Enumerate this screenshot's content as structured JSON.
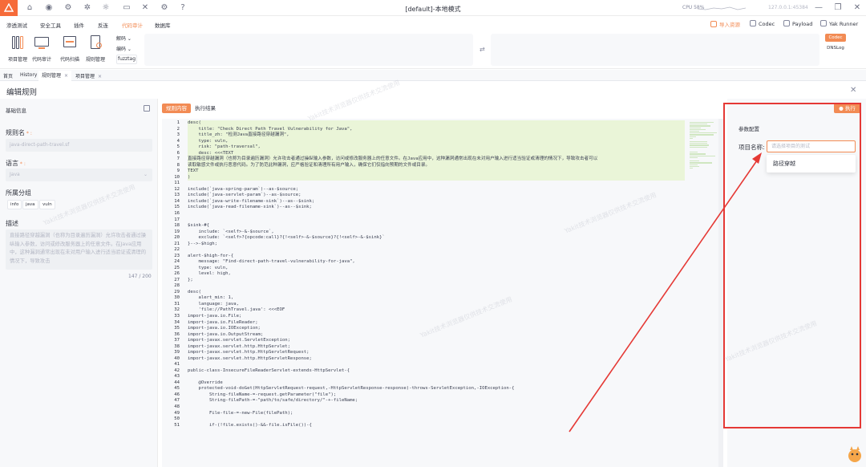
{
  "window": {
    "title": "[default]-本地模式",
    "cpu_label": "CPU 58%",
    "ip": "127.0.0.1:45384"
  },
  "menu": {
    "items": [
      "渗透测试",
      "安全工具",
      "插件",
      "反连",
      "代码审计",
      "数据库"
    ],
    "active": "代码审计",
    "right": {
      "import": "导入资源",
      "codec": "Codec",
      "payload": "Payload",
      "runner": "Yak Runner"
    }
  },
  "toolbar": {
    "tools": [
      "项目管理",
      "代码审计",
      "代码扫描",
      "规则管理"
    ],
    "decode": "解码",
    "encode": "编码",
    "fuzztag": "fuzztag",
    "codec_tag": "Codec",
    "dnslog": "DNSLog"
  },
  "tabs": [
    {
      "label": "首页"
    },
    {
      "label": "History"
    },
    {
      "label": "规则管理"
    },
    {
      "label": "项目管理"
    }
  ],
  "page": {
    "title": "编辑规则"
  },
  "left": {
    "section_title": "基础信息",
    "rule_name_label": "规则名",
    "rule_name_value": "java-direct-path-travel.sf",
    "language_label": "语言",
    "language_value": "Java",
    "group_label": "所属分组",
    "groups": [
      "info",
      "java",
      "vuln"
    ],
    "desc_label": "描述",
    "desc_value": "直接路径穿越漏洞（也称为目录遍历漏洞）允许攻击者通过操纵输入参数，访问或修改服务器上的任意文件。在Java应用中，这种漏洞通常出现在未对用户输入进行适当验证或清理的情况下，导致攻击",
    "desc_count": "147 / 200"
  },
  "code": {
    "tab_content": "规则内容",
    "tab_result": "执行结果",
    "lines": [
      "desc(",
      "    title: \"Check Direct Path Travel Vulnerability for Java\",",
      "    title_zh: \"检测Java直接路径穿越漏洞\",",
      "    type: vuln,",
      "    risk: \"path-traversal\",",
      "    desc: <<<TEXT",
      "直接路径穿越漏洞（也称为目录遍历漏洞）允许攻击者通过操纵输入参数，访问或修改服务器上的任意文件。在Java应用中，这种漏洞通常出现在未对用户输入进行适当验证或清理的情况下，导致攻击者可以",
      "读取敏感文件或执行恶意代码。为了防范此种漏洞，应严格验证和清理所有用户输入，确保它们仅指向预期的文件或目录。",
      "TEXT",
      ")",
      "",
      "include(`java-spring-param`)--as-$source;",
      "include(`java-servlet-param`)--as-$source;",
      "include(`java-write-filename-sink`)--as--$sink;",
      "include(`java-read-filename-sink`)--as--$sink;",
      "",
      "",
      "$sink-#{",
      "    include: `<self>-&-$source`,",
      "    exclude: `<self>?{opcode:call}?{!<self>-&-$source}?{!<self>-&-$sink}`",
      "}-->-$high;",
      "",
      "alert-$high-for-{",
      "    message: \"Find-direct-path-travel-vulnerability-for-java\",",
      "    type: vuln,",
      "    level: high,",
      "};",
      "",
      "desc(",
      "    alert_min: 1,",
      "    language: java,",
      "    'file://PathTravel.java': <<<EOF",
      "import-java.io.File;",
      "import-java.io.FileReader;",
      "import-java.io.IOException;",
      "import-java.io.OutputStream;",
      "import-javax.servlet.ServletException;",
      "import-javax.servlet.http.HttpServlet;",
      "import-javax.servlet.http.HttpServletRequest;",
      "import-javax.servlet.http.HttpServletResponse;",
      "",
      "public-class-InsecureFileReaderServlet-extends-HttpServlet-{",
      "",
      "    @Override",
      "    protected-void-doGet(HttpServletRequest-request,-HttpServletResponse-response)-throws-ServletException,-IOException-{",
      "        String-fileName-=-request.getParameter(\"file\");",
      "        String-filePath-=-\"path/to/safe/directory/\"-+-fileName;",
      "",
      "        File-file-=-new-File(filePath);",
      "",
      "        if-(!file.exists()-&&-file.isFile())-{"
    ]
  },
  "right": {
    "run_label": "执行",
    "section_title": "参数配置",
    "project_label": "项目名称:",
    "project_placeholder": "请选择项目的测试",
    "dropdown_option": "路径穿越"
  },
  "colors": {
    "accent": "#f28b54",
    "annotation": "#e53935"
  },
  "watermark": "Yakit技术浏览器仅供技术交流使用"
}
